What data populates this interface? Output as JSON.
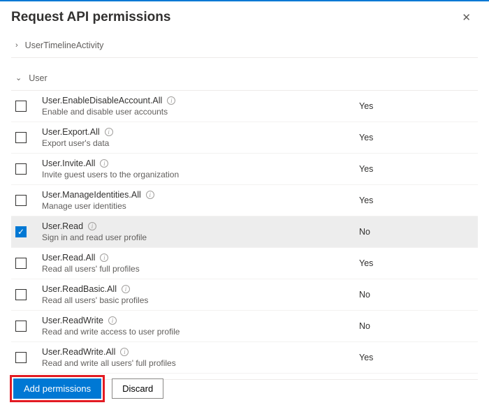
{
  "panel": {
    "title": "Request API permissions",
    "close_glyph": "✕"
  },
  "groups": {
    "collapsed": {
      "label": "UserTimelineActivity",
      "chevron": "›"
    },
    "expanded": {
      "label": "User",
      "chevron": "⌄"
    }
  },
  "permissions": [
    {
      "name": "User.EnableDisableAccount.All",
      "desc": "Enable and disable user accounts",
      "consent": "Yes",
      "checked": false
    },
    {
      "name": "User.Export.All",
      "desc": "Export user's data",
      "consent": "Yes",
      "checked": false
    },
    {
      "name": "User.Invite.All",
      "desc": "Invite guest users to the organization",
      "consent": "Yes",
      "checked": false
    },
    {
      "name": "User.ManageIdentities.All",
      "desc": "Manage user identities",
      "consent": "Yes",
      "checked": false
    },
    {
      "name": "User.Read",
      "desc": "Sign in and read user profile",
      "consent": "No",
      "checked": true
    },
    {
      "name": "User.Read.All",
      "desc": "Read all users' full profiles",
      "consent": "Yes",
      "checked": false
    },
    {
      "name": "User.ReadBasic.All",
      "desc": "Read all users' basic profiles",
      "consent": "No",
      "checked": false
    },
    {
      "name": "User.ReadWrite",
      "desc": "Read and write access to user profile",
      "consent": "No",
      "checked": false
    },
    {
      "name": "User.ReadWrite.All",
      "desc": "Read and write all users' full profiles",
      "consent": "Yes",
      "checked": false
    }
  ],
  "buttons": {
    "add": "Add permissions",
    "discard": "Discard"
  },
  "info_glyph": "i",
  "check_glyph": "✓"
}
